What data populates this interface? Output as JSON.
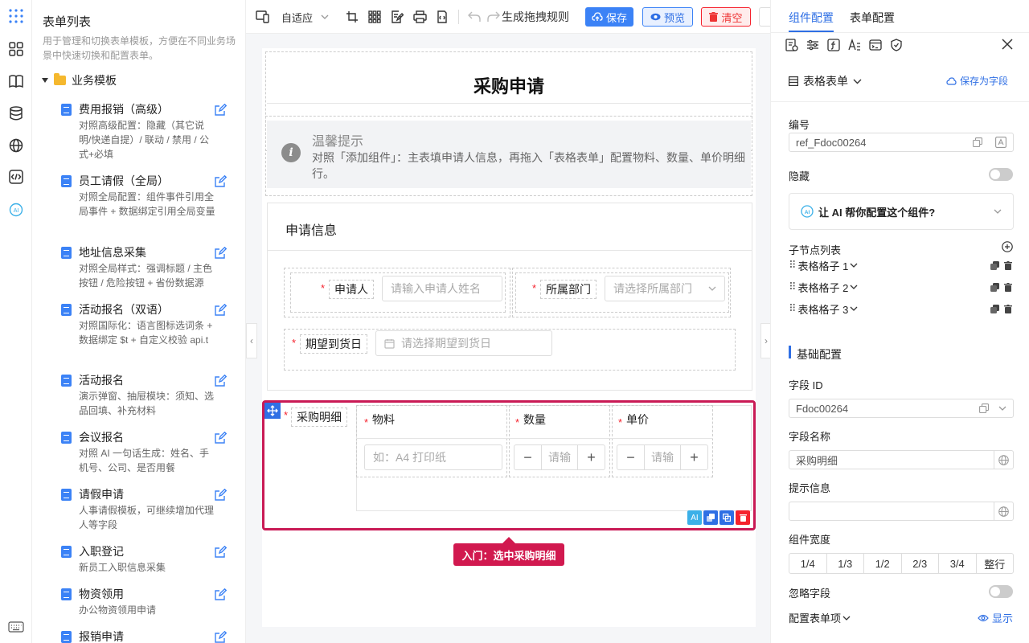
{
  "left_panel": {
    "title": "表单列表",
    "description": "用于管理和切换表单模板，方便在不同业务场景中快速切换和配置表单。",
    "folder": "业务模板",
    "templates": [
      {
        "name": "费用报销（高级）",
        "desc": "对照高级配置：隐藏（其它说明/快递自提）/ 联动 / 禁用 / 公式+必填"
      },
      {
        "name": "员工请假（全局）",
        "desc": "对照全局配置：组件事件引用全局事件 + 数据绑定引用全局变量"
      },
      {
        "name": "地址信息采集",
        "desc": "对照全局样式：强调标题 / 主色按钮 / 危险按钮 + 省份数据源"
      },
      {
        "name": "活动报名（双语）",
        "desc": "对照国际化：语言图标选词条 + 数据绑定 $t + 自定义校验 api.t"
      },
      {
        "name": "活动报名",
        "desc": "演示弹窗、抽屉模块：须知、选品回填、补充材料"
      },
      {
        "name": "会议报名",
        "desc": "对照 AI 一句话生成：姓名、手机号、公司、是否用餐"
      },
      {
        "name": "请假申请",
        "desc": "人事请假模板，可继续增加代理人等字段"
      },
      {
        "name": "入职登记",
        "desc": "新员工入职信息采集"
      },
      {
        "name": "物资领用",
        "desc": "办公物资领用申请"
      },
      {
        "name": "报销申请",
        "desc": ""
      }
    ]
  },
  "toolbar": {
    "adapt": "自适应",
    "rules": "生成拖拽规则",
    "save": "保存",
    "preview": "预览",
    "clear": "清空"
  },
  "form": {
    "title": "采购申请",
    "tip_title": "温馨提示",
    "tip_body": "对照「添加组件」：主表填申请人信息，再拖入「表格表单」配置物料、数量、单价明细行。",
    "section": "申请信息",
    "applicant_label": "申请人",
    "applicant_placeholder": "请输入申请人姓名",
    "dept_label": "所属部门",
    "dept_placeholder": "请选择所属部门",
    "date_label": "期望到货日",
    "date_placeholder": "请选择期望到货日",
    "detail_label": "采购明细",
    "col_material": "物料",
    "col_qty": "数量",
    "col_price": "单价",
    "material_placeholder": "如：A4 打印纸",
    "qty_placeholder": "请输",
    "price_placeholder": "请输",
    "guide_tag": "入门：选中采购明细"
  },
  "right_panel": {
    "tab_component": "组件配置",
    "tab_form": "表单配置",
    "component_type": "表格表单",
    "save_as_field": "保存为字段",
    "id_label": "编号",
    "id_value": "ref_Fdoc00264",
    "hidden_label": "隐藏",
    "ai_prompt": "让 AI 帮你配置这个组件?",
    "children_label": "子节点列表",
    "children": [
      "表格格子 1",
      "表格格子 2",
      "表格格子 3"
    ],
    "basic_config": "基础配置",
    "field_id_label": "字段 ID",
    "field_id_value": "Fdoc00264",
    "field_name_label": "字段名称",
    "field_name_value": "采购明细",
    "hint_label": "提示信息",
    "hint_value": "",
    "width_label": "组件宽度",
    "widths": [
      "1/4",
      "1/3",
      "1/2",
      "2/3",
      "3/4",
      "整行"
    ],
    "ignore_label": "忽略字段",
    "config_items_label": "配置表单项",
    "show_label": "显示"
  },
  "colors": {
    "primary": "#3b82f6",
    "danger": "#f5222d",
    "selected": "#c91a55"
  }
}
